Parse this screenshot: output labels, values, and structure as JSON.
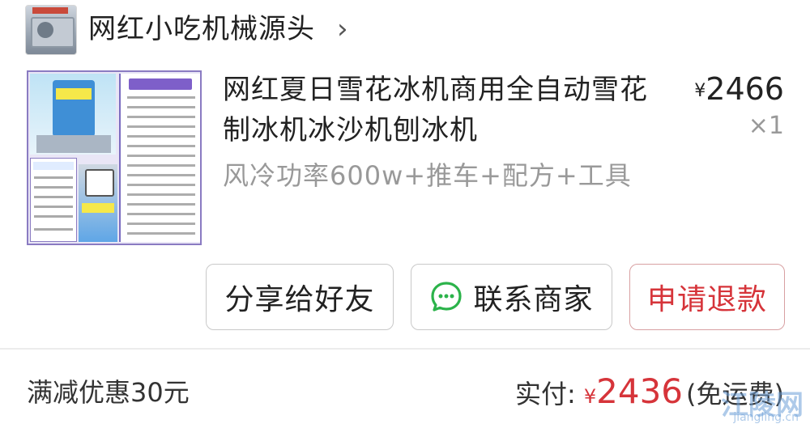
{
  "shop": {
    "name": "网红小吃机械源头",
    "chevron": "›"
  },
  "product": {
    "title": "网红夏日雪花冰机商用全自动雪花制冰机冰沙机刨冰机",
    "price_symbol": "¥",
    "price_value": "2466",
    "quantity": "×1",
    "sku": "风冷功率600w+推车+配方+工具"
  },
  "actions": {
    "share_label": "分享给好友",
    "contact_label": "联系商家",
    "refund_label": "申请退款"
  },
  "summary": {
    "discount": "满减优惠30元",
    "paid_label": "实付:",
    "paid_symbol": "¥",
    "paid_amount": "2436",
    "shipping_note": "(免运费)"
  },
  "watermark": {
    "main": "江陵网",
    "sub": "jiangling.cn"
  },
  "colors": {
    "accent_red": "#d6343a",
    "muted_gray": "#999999",
    "wechat_green": "#2bb34a"
  },
  "icons": [
    "chevron-right-icon",
    "wechat-chat-icon"
  ]
}
